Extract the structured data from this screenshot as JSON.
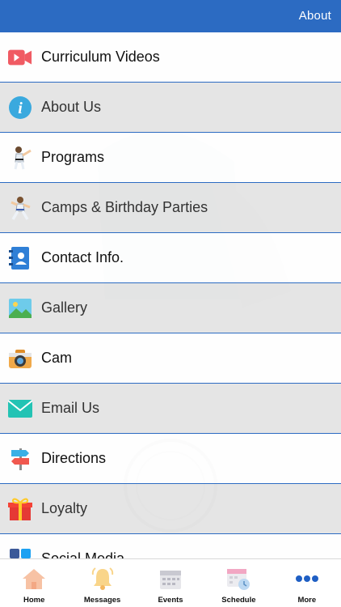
{
  "header": {
    "title": "About"
  },
  "menu": [
    {
      "label": "Curriculum Videos",
      "icon": "video-camera-icon"
    },
    {
      "label": "About Us",
      "icon": "info-icon"
    },
    {
      "label": "Programs",
      "icon": "martial-arts-kick-icon"
    },
    {
      "label": "Camps & Birthday Parties",
      "icon": "karate-figure-icon"
    },
    {
      "label": "Contact Info.",
      "icon": "contact-book-icon"
    },
    {
      "label": "Gallery",
      "icon": "gallery-icon"
    },
    {
      "label": "Cam",
      "icon": "camera-icon"
    },
    {
      "label": "Email Us",
      "icon": "envelope-icon"
    },
    {
      "label": "Directions",
      "icon": "signpost-icon"
    },
    {
      "label": "Loyalty",
      "icon": "gift-icon"
    },
    {
      "label": "Social Media",
      "icon": "social-media-icon"
    }
  ],
  "tabs": [
    {
      "label": "Home",
      "icon": "home-icon"
    },
    {
      "label": "Messages",
      "icon": "bell-icon"
    },
    {
      "label": "Events",
      "icon": "calendar-icon"
    },
    {
      "label": "Schedule",
      "icon": "schedule-icon"
    },
    {
      "label": "More",
      "icon": "more-icon"
    }
  ],
  "colors": {
    "header": "#2c6bc2",
    "divider": "#2c6bc2",
    "more_dots": "#1f5fc4"
  }
}
